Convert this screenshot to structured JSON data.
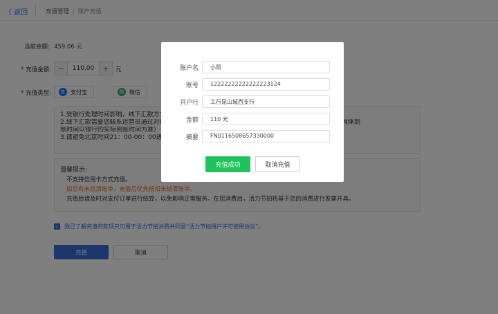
{
  "header": {
    "back_label": "〈 返回",
    "breadcrumb_parent": "充值管理",
    "breadcrumb_sep": "/",
    "breadcrumb_current": "账户充值"
  },
  "form": {
    "balance_label": "当前余额:",
    "balance_value": "459.06 元",
    "amount_label": "充值金额:",
    "amount_minus": "−",
    "amount_value": "110.00",
    "amount_plus": "+",
    "amount_unit": "元",
    "type_label": "充值类型:",
    "pay_alipay": "支付宝",
    "pay_wechat": "微信"
  },
  "notice_lines": [
    "1.受银行处理时间影响，线下汇款方式到账会有延误，强烈建议采用支付宝在线充值方式，实时到账。",
    "2.线下汇款需要您联系运营员通过对账后才能确认到账，部分银行汇款到账周期为1-3天，跨行2-5天（具体到",
    "账时间以银行的实际到账时间为准）",
    "3.请避免北京时间21：00-00：00进行充值，以免充值失败。"
  ],
  "tips": {
    "title": "温馨提示:",
    "line1": "不支持信用卡方式充值。",
    "line2": "如您有未结清账单，充值后优先抵扣未结清账单。",
    "line3": "充值后请及时对支付订单进行结算，以免影响正常服务。在您消费后，活力节拍将基于您的消费进行发票开具。"
  },
  "agreement": {
    "check": "✓",
    "text": "我已了解充值的款项只可用于活力节拍消费并同意“活力节拍用户许可使用协议”。"
  },
  "actions": {
    "submit": "充值",
    "cancel": "取消"
  },
  "modal": {
    "rows": [
      {
        "label": "账户名",
        "value": "小阳"
      },
      {
        "label": "账号",
        "value": "12222222222222223124"
      },
      {
        "label": "开户行",
        "value": "工行昆山城西支行"
      },
      {
        "label": "金额",
        "value": "110 元"
      },
      {
        "label": "摘要",
        "value": "FN0116508657330000"
      }
    ],
    "ok": "充值成功",
    "cancel": "取消充值"
  },
  "colors": {
    "primary": "#3a6fd8",
    "success": "#20c35a",
    "warning": "#e0702d",
    "alipay": "#1677ff",
    "wechat": "#2aae67"
  },
  "icons": {
    "alipay": "alipay-icon",
    "wechat": "wechat-icon"
  }
}
